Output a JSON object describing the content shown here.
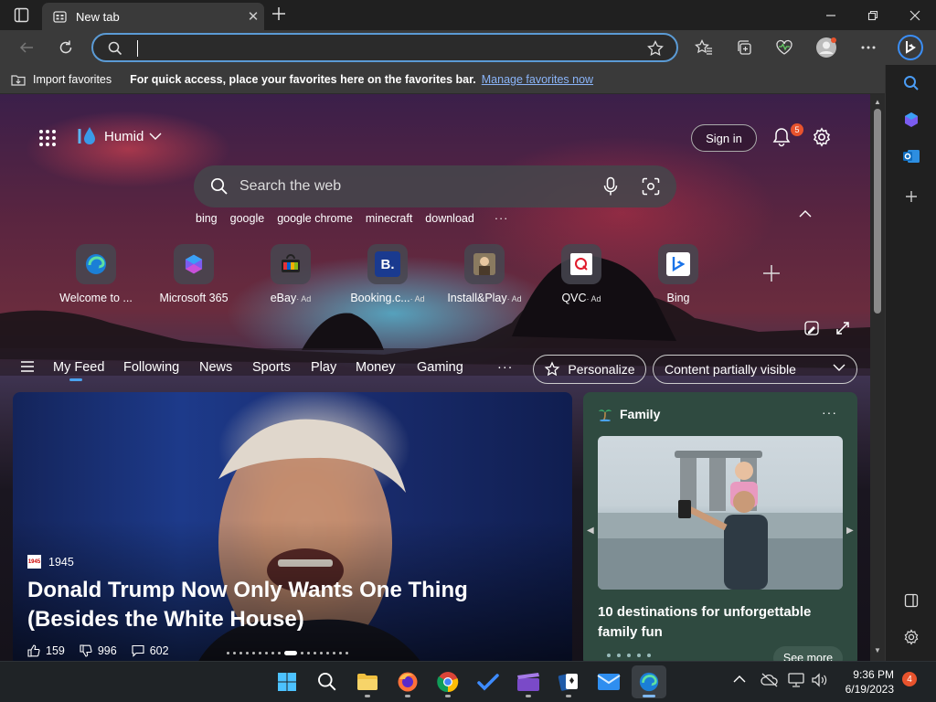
{
  "browser": {
    "tab_title": "New tab",
    "address_value": "",
    "favorites_bar": {
      "import_label": "Import favorites",
      "message": "For quick access, place your favorites here on the favorites bar.",
      "link": "Manage favorites now"
    }
  },
  "newtab": {
    "weather": {
      "condition": "Humid"
    },
    "sign_in": "Sign in",
    "notification_count": "5",
    "search": {
      "placeholder": "Search the web",
      "trending": [
        "bing",
        "google",
        "google chrome",
        "minecraft",
        "download"
      ]
    },
    "quick_links": [
      {
        "label": "Welcome to ...",
        "ad": "",
        "icon": "edge-icon"
      },
      {
        "label": "Microsoft 365",
        "ad": "",
        "icon": "m365-icon"
      },
      {
        "label": "eBay",
        "ad": "· Ad",
        "icon": "ebay-icon"
      },
      {
        "label": "Booking.c...",
        "ad": "· Ad",
        "icon": "booking-icon"
      },
      {
        "label": "Install&Play",
        "ad": "· Ad",
        "icon": "installplay-icon"
      },
      {
        "label": "QVC",
        "ad": "· Ad",
        "icon": "qvc-icon"
      },
      {
        "label": "Bing",
        "ad": "",
        "icon": "bing-icon"
      }
    ],
    "feed_tabs": [
      "My Feed",
      "Following",
      "News",
      "Sports",
      "Play",
      "Money",
      "Gaming"
    ],
    "active_feed_tab": "My Feed",
    "personalize": "Personalize",
    "content_visibility": "Content partially visible",
    "hero": {
      "source_logo_text": "1945",
      "source": "1945",
      "headline": "Donald Trump Now Only Wants One Thing (Besides the White House)",
      "likes": "159",
      "dislikes": "996",
      "comments": "602"
    },
    "family_card": {
      "category": "Family",
      "title": "10 destinations for unforgettable family fun",
      "see_more": "See more"
    }
  },
  "taskbar": {
    "apps": [
      "start",
      "search",
      "file-explorer",
      "firefox",
      "chrome",
      "todo",
      "clipchamp",
      "solitaire",
      "mail",
      "edge"
    ],
    "time": "9:36 PM",
    "date": "6/19/2023",
    "notification_count": "4"
  },
  "colors": {
    "accent": "#5b9bd5",
    "badge": "#e8532d",
    "family_card_bg": "#2f4a40"
  }
}
